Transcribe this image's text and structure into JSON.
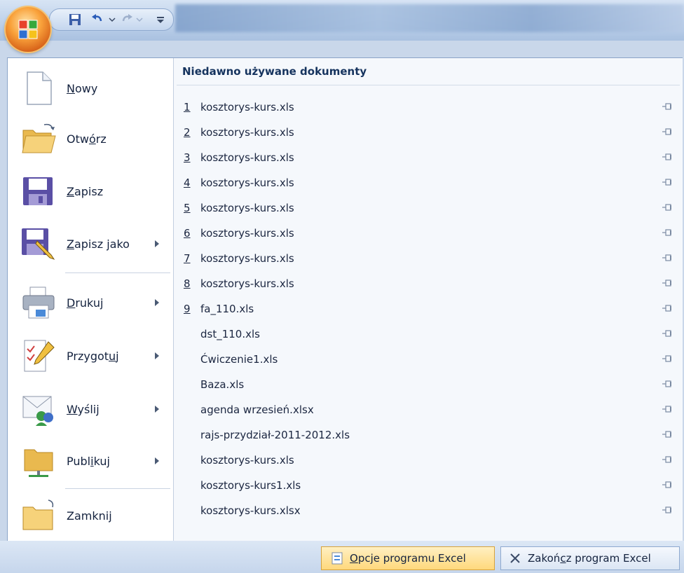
{
  "quick_access": {
    "save_icon": "save-icon",
    "undo_icon": "undo-icon",
    "redo_icon": "redo-icon",
    "customize_icon": "customize-qat-icon"
  },
  "left_menu": [
    {
      "id": "new",
      "label": "Nowy",
      "u": "N",
      "rest": "owy",
      "icon": "new-document-icon",
      "submenu": false
    },
    {
      "id": "open",
      "label": "Otwórz",
      "pre": "Otw",
      "u": "ó",
      "rest": "rz",
      "icon": "open-folder-icon",
      "submenu": false
    },
    {
      "id": "save",
      "label": "Zapisz",
      "u": "Z",
      "rest": "apisz",
      "icon": "save-icon",
      "submenu": false
    },
    {
      "id": "save-as",
      "label": "Zapisz jako",
      "u": "Z",
      "rest": "apisz jako",
      "icon": "save-as-icon",
      "submenu": true
    },
    {
      "id": "print",
      "label": "Drukuj",
      "u": "D",
      "rest": "rukuj",
      "icon": "printer-icon",
      "submenu": true
    },
    {
      "id": "prepare",
      "label": "Przygotuj",
      "pre": "Przygot",
      "u": "u",
      "rest": "j",
      "icon": "prepare-pen-icon",
      "submenu": true
    },
    {
      "id": "send",
      "label": "Wyślij",
      "u": "W",
      "rest": "yślij",
      "icon": "send-icon",
      "submenu": true
    },
    {
      "id": "publish",
      "label": "Publikuj",
      "pre": "Publ",
      "u": "i",
      "rest": "kuj",
      "icon": "publish-folder-icon",
      "submenu": true
    },
    {
      "id": "close",
      "label": "Zamknij",
      "pre": "Zamkni",
      "u": "j",
      "rest": "",
      "icon": "close-folder-icon",
      "submenu": false
    }
  ],
  "recent": {
    "title": "Niedawno używane dokumenty",
    "items": [
      {
        "num": "1",
        "name": "kosztorys-kurs.xls"
      },
      {
        "num": "2",
        "name": "kosztorys-kurs.xls"
      },
      {
        "num": "3",
        "name": "kosztorys-kurs.xls"
      },
      {
        "num": "4",
        "name": "kosztorys-kurs.xls"
      },
      {
        "num": "5",
        "name": "kosztorys-kurs.xls"
      },
      {
        "num": "6",
        "name": "kosztorys-kurs.xls"
      },
      {
        "num": "7",
        "name": "kosztorys-kurs.xls"
      },
      {
        "num": "8",
        "name": "kosztorys-kurs.xls"
      },
      {
        "num": "9",
        "name": "fa_110.xls"
      },
      {
        "num": "",
        "name": "dst_110.xls"
      },
      {
        "num": "",
        "name": "Ćwiczenie1.xls"
      },
      {
        "num": "",
        "name": "Baza.xls"
      },
      {
        "num": "",
        "name": "agenda wrzesień.xlsx"
      },
      {
        "num": "",
        "name": "rajs-przydział-2011-2012.xls"
      },
      {
        "num": "",
        "name": "kosztorys-kurs.xls"
      },
      {
        "num": "",
        "name": "kosztorys-kurs1.xls"
      },
      {
        "num": "",
        "name": "kosztorys-kurs.xlsx"
      }
    ]
  },
  "bottom": {
    "options_label": "Opcje programu Excel",
    "options_u": "O",
    "options_rest": "pcje programu Excel",
    "exit_label": "Zakończ program Excel",
    "exit_pre": "Zakoń",
    "exit_u": "c",
    "exit_rest": "z program Excel"
  }
}
